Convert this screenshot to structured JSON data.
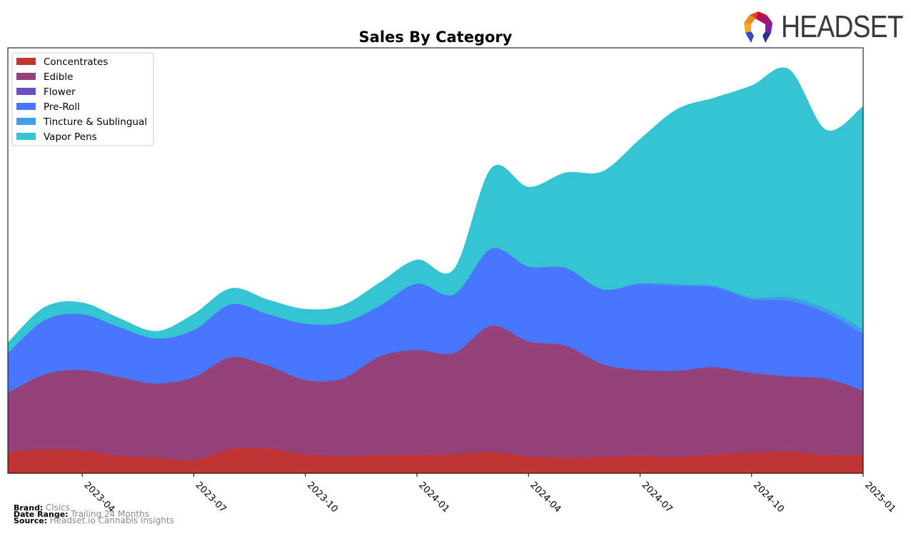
{
  "logo": {
    "text": "HEADSET",
    "icon": "headset-logo-icon"
  },
  "footer": {
    "brand_label": "Brand:",
    "brand_value": "Clsics",
    "date_range_label": "Date Range:",
    "date_range_value": "Trailing 24 Months",
    "source_label": "Source:",
    "source_value": "Headset.io Cannabis Insights"
  },
  "chart_data": {
    "type": "area",
    "stacked": true,
    "smoothed": true,
    "title": "Sales By Category",
    "xlabel": "",
    "ylabel": "",
    "y_axis_visible": false,
    "y_units": "relative (unlabeled)",
    "grid": false,
    "legend_position": "top-left",
    "x": [
      "2023-02",
      "2023-03",
      "2023-04",
      "2023-05",
      "2023-06",
      "2023-07",
      "2023-08",
      "2023-09",
      "2023-10",
      "2023-11",
      "2023-12",
      "2024-01",
      "2024-02",
      "2024-03",
      "2024-04",
      "2024-05",
      "2024-06",
      "2024-07",
      "2024-08",
      "2024-09",
      "2024-10",
      "2024-11",
      "2024-12",
      "2025-01"
    ],
    "x_ticks": [
      "2023-04",
      "2023-07",
      "2023-10",
      "2024-01",
      "2024-04",
      "2024-07",
      "2024-10",
      "2025-01"
    ],
    "ylim": [
      0,
      596
    ],
    "series": [
      {
        "name": "Concentrates",
        "color": "#c03434",
        "values": [
          30,
          34,
          32,
          25,
          22,
          19,
          34,
          35,
          27,
          24,
          26,
          26,
          27,
          30,
          24,
          22,
          23,
          25,
          23,
          27,
          29,
          31,
          26,
          26
        ]
      },
      {
        "name": "Edible",
        "color": "#96427a",
        "values": [
          83,
          105,
          113,
          110,
          104,
          116,
          129,
          116,
          104,
          109,
          138,
          147,
          142,
          177,
          161,
          157,
          130,
          120,
          121,
          122,
          112,
          105,
          107,
          90
        ]
      },
      {
        "name": "Flower",
        "color": "#6a4fc0",
        "values": [
          0,
          0,
          0,
          0,
          0,
          0,
          0,
          0,
          0,
          0,
          0,
          0,
          0,
          0,
          0,
          0,
          0,
          0,
          0,
          0,
          0,
          0,
          0,
          0
        ]
      },
      {
        "name": "Pre-Roll",
        "color": "#4876ff",
        "values": [
          56,
          76,
          78,
          70,
          63,
          66,
          74,
          72,
          79,
          78,
          71,
          93,
          82,
          108,
          105,
          109,
          105,
          120,
          119,
          112,
          103,
          106,
          92,
          80
        ]
      },
      {
        "name": "Tincture & Sublingual",
        "color": "#3ea0e8",
        "values": [
          0,
          0,
          0,
          0,
          0,
          0,
          0,
          0,
          0,
          0,
          0,
          0,
          0,
          0,
          0,
          0,
          0,
          2,
          2,
          2,
          3,
          5,
          6,
          6
        ]
      },
      {
        "name": "Vapor Pens",
        "color": "#35c4d2",
        "values": [
          14,
          18,
          16,
          12,
          10,
          22,
          22,
          20,
          20,
          24,
          32,
          33,
          35,
          112,
          111,
          133,
          165,
          201,
          245,
          263,
          296,
          319,
          250,
          312
        ]
      }
    ]
  }
}
